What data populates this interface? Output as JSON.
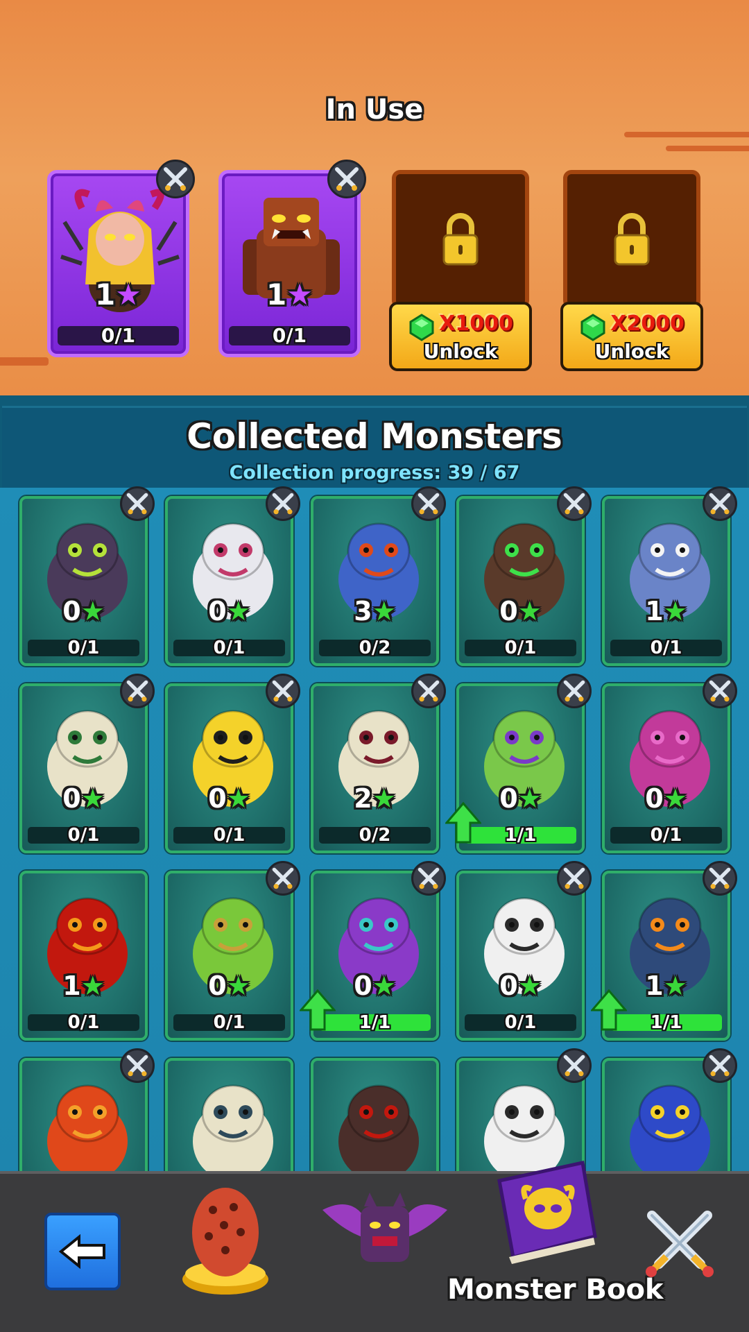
{
  "in_use": {
    "title": "In Use",
    "slots": [
      {
        "name": "demon-girl",
        "stars": "1",
        "progress": "0/1"
      },
      {
        "name": "rock-golem",
        "stars": "1",
        "progress": "0/1"
      }
    ],
    "locked_slots": [
      {
        "price": "X1000",
        "label": "Unlock"
      },
      {
        "price": "X2000",
        "label": "Unlock"
      }
    ]
  },
  "collected": {
    "title": "Collected Monsters",
    "progress_text": "Collection progress: 39 / 67",
    "monsters": [
      {
        "name": "bat",
        "stars": "0",
        "progress": "0/1",
        "full": false,
        "upgrade": false,
        "badge": true
      },
      {
        "name": "ghost-skull",
        "stars": "0",
        "progress": "0/1",
        "full": false,
        "upgrade": false,
        "badge": true
      },
      {
        "name": "lava-golem",
        "stars": "3",
        "progress": "0/2",
        "full": false,
        "upgrade": false,
        "badge": true
      },
      {
        "name": "tree-ent",
        "stars": "0",
        "progress": "0/1",
        "full": false,
        "upgrade": false,
        "badge": true
      },
      {
        "name": "wolf",
        "stars": "1",
        "progress": "0/1",
        "full": false,
        "upgrade": false,
        "badge": true
      },
      {
        "name": "skeleton-hat",
        "stars": "0",
        "progress": "0/1",
        "full": false,
        "upgrade": false,
        "badge": true
      },
      {
        "name": "bee",
        "stars": "0",
        "progress": "0/1",
        "full": false,
        "upgrade": false,
        "badge": true
      },
      {
        "name": "skeleton-mage",
        "stars": "2",
        "progress": "0/2",
        "full": false,
        "upgrade": false,
        "badge": true
      },
      {
        "name": "goblin-medusa",
        "stars": "0",
        "progress": "1/1",
        "full": true,
        "upgrade": true,
        "badge": true
      },
      {
        "name": "dragon",
        "stars": "0",
        "progress": "0/1",
        "full": false,
        "upgrade": false,
        "badge": true
      },
      {
        "name": "fire-demon",
        "stars": "1",
        "progress": "0/1",
        "full": false,
        "upgrade": false,
        "badge": false
      },
      {
        "name": "snake",
        "stars": "0",
        "progress": "0/1",
        "full": false,
        "upgrade": false,
        "badge": true
      },
      {
        "name": "carnivore-plant",
        "stars": "0",
        "progress": "1/1",
        "full": true,
        "upgrade": true,
        "badge": true
      },
      {
        "name": "skull",
        "stars": "0",
        "progress": "0/1",
        "full": false,
        "upgrade": false,
        "badge": true
      },
      {
        "name": "scarecrow",
        "stars": "1",
        "progress": "1/1",
        "full": true,
        "upgrade": true,
        "badge": true
      },
      {
        "name": "fire-worm",
        "stars": "",
        "progress": "",
        "full": false,
        "upgrade": false,
        "badge": true
      },
      {
        "name": "skeleton-hood",
        "stars": "",
        "progress": "",
        "full": false,
        "upgrade": false,
        "badge": false
      },
      {
        "name": "dark-golem",
        "stars": "",
        "progress": "",
        "full": false,
        "upgrade": false,
        "badge": false
      },
      {
        "name": "skeleton",
        "stars": "",
        "progress": "",
        "full": false,
        "upgrade": false,
        "badge": true
      },
      {
        "name": "knight",
        "stars": "",
        "progress": "",
        "full": false,
        "upgrade": false,
        "badge": true
      }
    ]
  },
  "nav": {
    "items": [
      "back",
      "egg",
      "monsters",
      "monster-book",
      "battle"
    ],
    "active_label": "Monster Book"
  },
  "colors": {
    "purple_card": "#8a33e0",
    "teal_card": "#1d6b67",
    "green_border": "#2fae6a",
    "progress_full": "#2ee23a",
    "price_red": "#e81b0e",
    "unlock_yellow": "#f7c12e"
  }
}
